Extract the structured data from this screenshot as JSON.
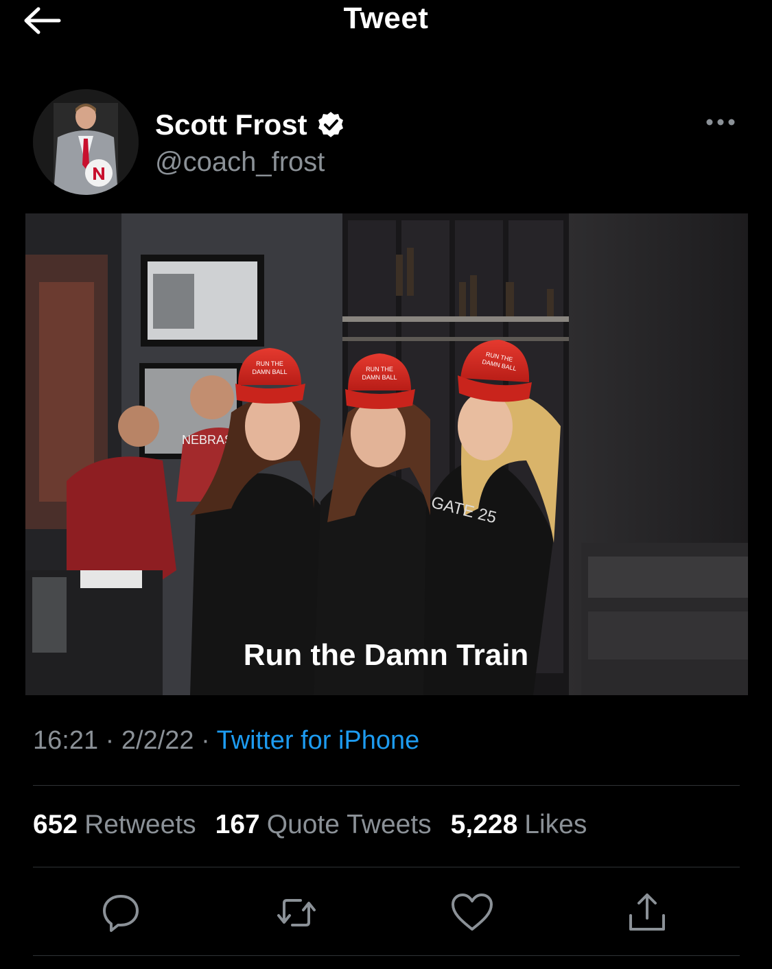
{
  "header": {
    "title": "Tweet"
  },
  "author": {
    "name": "Scott Frost",
    "handle": "@coach_frost",
    "verified": true
  },
  "media": {
    "caption": "Run the Damn Train",
    "hat_text_line1": "RUN THE",
    "hat_text_line2": "DAMN BALL",
    "shirt_text": "GATE 25",
    "wall_text": "NEBRASKA"
  },
  "meta": {
    "time": "16:21",
    "date": "2/2/22",
    "source": "Twitter for iPhone",
    "sep": "·"
  },
  "stats": {
    "retweets_count": "652",
    "retweets_label": "Retweets",
    "quotes_count": "167",
    "quotes_label": "Quote Tweets",
    "likes_count": "5,228",
    "likes_label": "Likes"
  },
  "icons": [
    "back-arrow-icon",
    "verified-badge-icon",
    "more-options-icon",
    "reply-icon",
    "retweet-icon",
    "like-icon",
    "share-icon"
  ],
  "colors": {
    "background": "#000000",
    "accent": "#1d9bf0",
    "muted": "#8b9197",
    "divider": "#2f3336",
    "hat": "#d42620"
  }
}
